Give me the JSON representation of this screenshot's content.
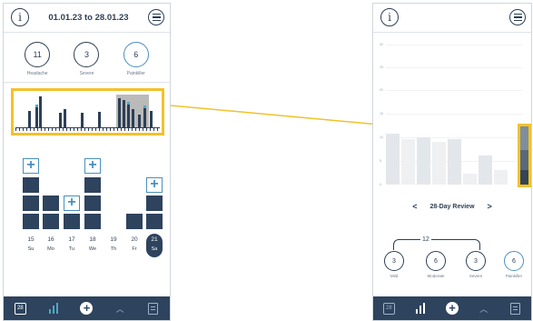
{
  "left": {
    "date_range": "01.01.23 to 28.01.23",
    "counters": [
      {
        "value": "11",
        "label": "Headache",
        "accent": false
      },
      {
        "value": "3",
        "label": "Severe",
        "accent": false
      },
      {
        "value": "6",
        "label": "Painkiller",
        "accent": true
      }
    ],
    "days": [
      {
        "num": "15",
        "name": "Su",
        "active": false
      },
      {
        "num": "16",
        "name": "Mo",
        "active": false
      },
      {
        "num": "17",
        "name": "Tu",
        "active": false
      },
      {
        "num": "18",
        "name": "We",
        "active": false
      },
      {
        "num": "19",
        "name": "Th",
        "active": false
      },
      {
        "num": "20",
        "name": "Fr",
        "active": false
      },
      {
        "num": "21",
        "name": "Sa",
        "active": true
      }
    ],
    "tab_calendar_number": "28"
  },
  "right": {
    "y_ticks": [
      "30",
      "25",
      "20",
      "15",
      "10",
      "5",
      "0"
    ],
    "review_label": "28-Day Review",
    "total": "12",
    "counters": [
      {
        "value": "3",
        "label": "Mild",
        "accent": false
      },
      {
        "value": "6",
        "label": "Moderate",
        "accent": false
      },
      {
        "value": "3",
        "label": "Severe",
        "accent": false
      },
      {
        "value": "6",
        "label": "Painkiller",
        "accent": true
      }
    ],
    "tab_calendar_number": "28"
  },
  "colors": {
    "navy": "#2e435d",
    "accent_blue": "#4a8fbf",
    "highlight_yellow": "#f2c22b"
  },
  "icons": [
    "info-icon",
    "menu-icon",
    "calendar-icon",
    "statistics-icon",
    "add-icon",
    "chevron-up-icon",
    "notes-icon"
  ]
}
